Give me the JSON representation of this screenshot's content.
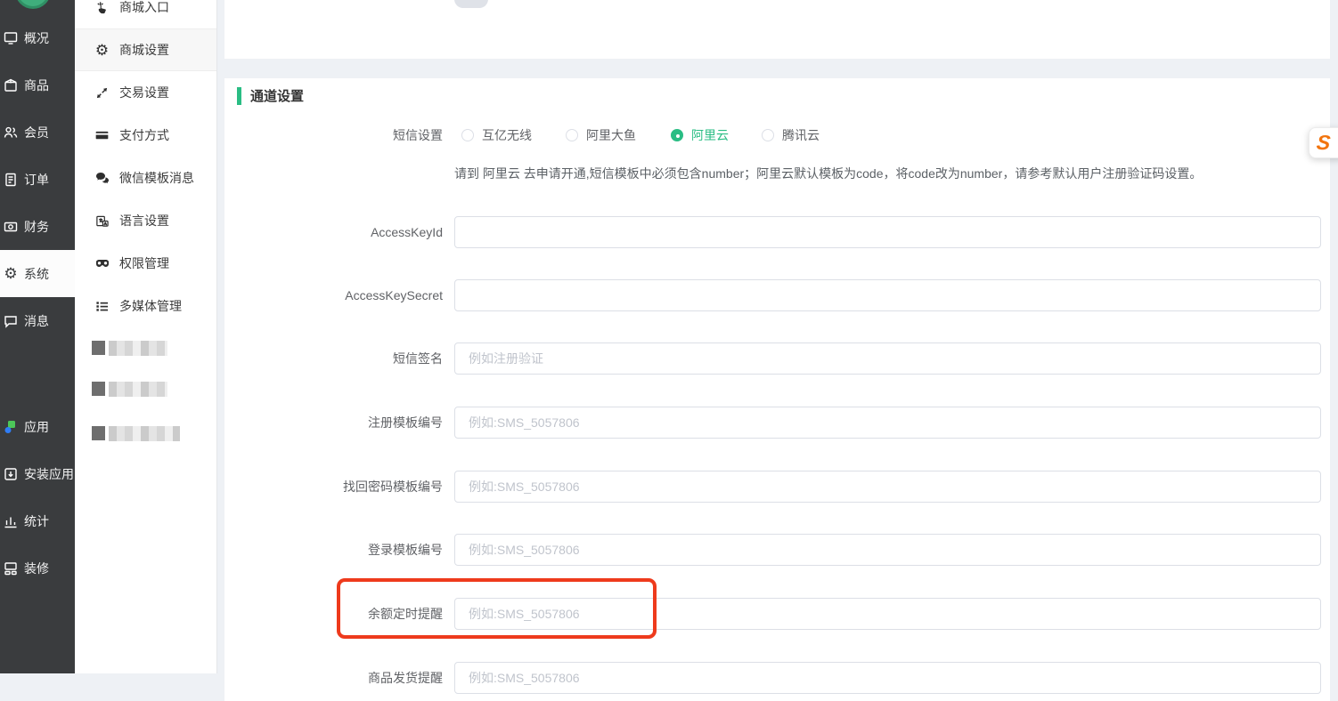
{
  "accent_green": "#2abd84",
  "annotation_color": "#ee3a1c",
  "sidebar": {
    "items": [
      {
        "label": "概况"
      },
      {
        "label": "商品"
      },
      {
        "label": "会员"
      },
      {
        "label": "订单"
      },
      {
        "label": "财务"
      },
      {
        "label": "系统",
        "active": true
      },
      {
        "label": "消息"
      },
      {
        "label": "应用"
      },
      {
        "label": "安装应用"
      },
      {
        "label": "统计"
      },
      {
        "label": "装修"
      }
    ]
  },
  "submenu": {
    "items": [
      {
        "label": "商城入口"
      },
      {
        "label": "商城设置",
        "active": true
      },
      {
        "label": "交易设置"
      },
      {
        "label": "支付方式"
      },
      {
        "label": "微信模板消息"
      },
      {
        "label": "语言设置"
      },
      {
        "label": "权限管理"
      },
      {
        "label": "多媒体管理"
      }
    ],
    "redacted_items": 3
  },
  "content": {
    "section_title": "通道设置",
    "sms": {
      "label": "短信设置",
      "options": [
        {
          "label": "互亿无线",
          "selected": false
        },
        {
          "label": "阿里大鱼",
          "selected": false
        },
        {
          "label": "阿里云",
          "selected": true
        },
        {
          "label": "腾讯云",
          "selected": false
        }
      ],
      "help": "请到 阿里云 去申请开通,短信模板中必须包含number；阿里云默认模板为code，将code改为number，请参考默认用户注册验证码设置。"
    },
    "fields": [
      {
        "label": "AccessKeyId",
        "value": "",
        "placeholder": ""
      },
      {
        "label": "AccessKeySecret",
        "value": "",
        "placeholder": ""
      },
      {
        "label": "短信签名",
        "value": "",
        "placeholder": "例如注册验证"
      },
      {
        "label": "注册模板编号",
        "value": "",
        "placeholder": "例如:SMS_5057806"
      },
      {
        "label": "找回密码模板编号",
        "value": "",
        "placeholder": "例如:SMS_5057806"
      },
      {
        "label": "登录模板编号",
        "value": "",
        "placeholder": "例如:SMS_5057806"
      },
      {
        "label": "余额定时提醒",
        "value": "",
        "placeholder": "例如:SMS_5057806",
        "highlighted": true
      },
      {
        "label": "商品发货提醒",
        "value": "",
        "placeholder": "例如:SMS_5057806"
      }
    ]
  },
  "side_widget": {
    "letter": "S"
  }
}
